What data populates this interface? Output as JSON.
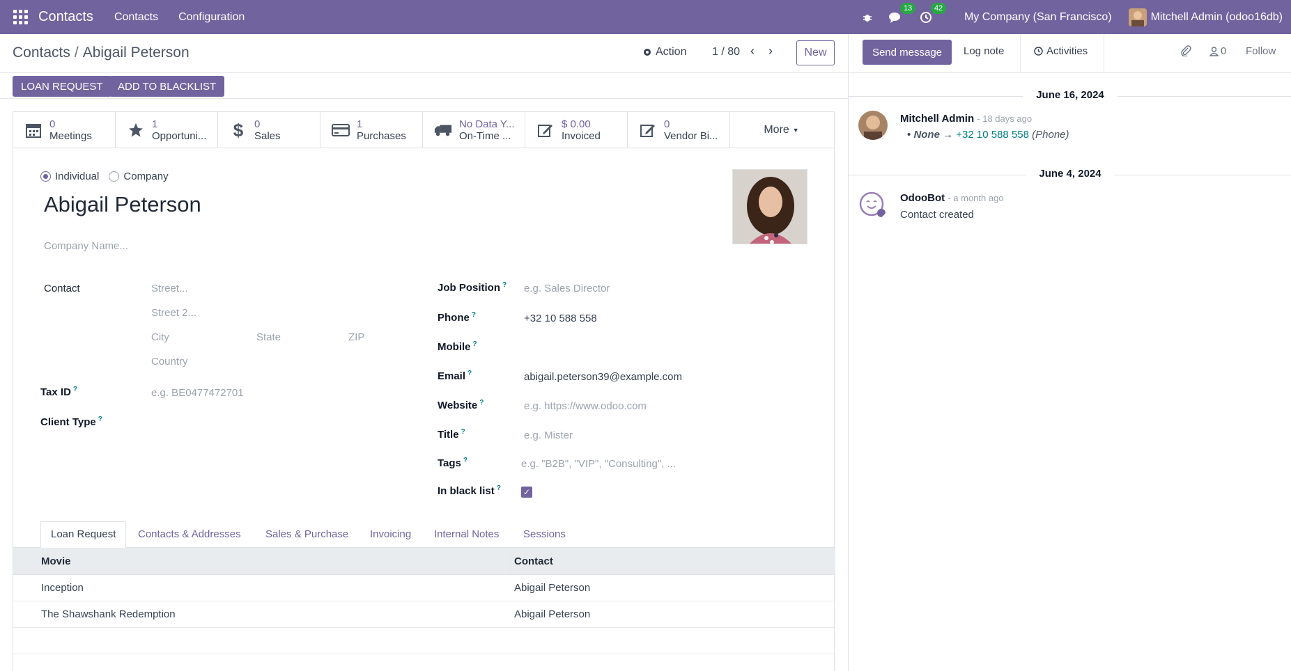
{
  "navbar": {
    "brand": "Contacts",
    "menus": [
      "Contacts",
      "Configuration"
    ],
    "messages_count": "13",
    "activities_count": "42",
    "company": "My Company (San Francisco)",
    "user": "Mitchell Admin (odoo16db)"
  },
  "control_panel": {
    "breadcrumb_parent": "Contacts",
    "breadcrumb_separator": "/",
    "breadcrumb_current": "Abigail Peterson",
    "action_label": "Action",
    "pager": "1 / 80",
    "new_label": "New"
  },
  "header_buttons": {
    "loan_request": "LOAN REQUEST",
    "add_to_blacklist": "ADD TO BLACKLIST"
  },
  "stat_buttons": [
    {
      "value": "0",
      "label": "Meetings",
      "icon": "calendar-icon"
    },
    {
      "value": "1",
      "label": "Opportuni...",
      "icon": "star-icon"
    },
    {
      "value": "0",
      "label": "Sales",
      "icon": "dollar-icon"
    },
    {
      "value": "1",
      "label": "Purchases",
      "icon": "credit-card-icon"
    },
    {
      "value": "No Data Y...",
      "label": "On-Time ...",
      "icon": "truck-icon"
    },
    {
      "value": "$ 0.00",
      "label": "Invoiced",
      "icon": "pencil-square-icon"
    },
    {
      "value": "0",
      "label": "Vendor Bi...",
      "icon": "pencil-square-icon"
    }
  ],
  "more_label": "More",
  "form": {
    "type_individual": "Individual",
    "type_company": "Company",
    "name": "Abigail Peterson",
    "company_name_placeholder": "Company Name...",
    "contact_label": "Contact",
    "street_placeholder": "Street...",
    "street2_placeholder": "Street 2...",
    "city_placeholder": "City",
    "state_placeholder": "State",
    "zip_placeholder": "ZIP",
    "country_placeholder": "Country",
    "tax_id_label": "Tax ID",
    "tax_id_placeholder": "e.g. BE0477472701",
    "client_type_label": "Client Type",
    "job_position_label": "Job Position",
    "job_position_placeholder": "e.g. Sales Director",
    "phone_label": "Phone",
    "phone_value": "+32 10 588 558",
    "mobile_label": "Mobile",
    "email_label": "Email",
    "email_value": "abigail.peterson39@example.com",
    "website_label": "Website",
    "website_placeholder": "e.g. https://www.odoo.com",
    "title_label": "Title",
    "title_placeholder": "e.g. Mister",
    "tags_label": "Tags",
    "tags_placeholder": "e.g. \"B2B\", \"VIP\", \"Consulting\", ...",
    "blacklist_label": "In black list",
    "help_mark": "?"
  },
  "tabs": [
    "Loan Request",
    "Contacts & Addresses",
    "Sales & Purchase",
    "Invoicing",
    "Internal Notes",
    "Sessions"
  ],
  "table": {
    "columns": [
      "Movie",
      "Contact"
    ],
    "rows": [
      [
        "Inception",
        "Abigail Peterson"
      ],
      [
        "The Shawshank Redemption",
        "Abigail Peterson"
      ]
    ]
  },
  "chatter": {
    "send_message": "Send message",
    "log_note": "Log note",
    "activities": "Activities",
    "followers_count": "0",
    "follow": "Follow",
    "date1": "June 16, 2024",
    "msg1_author": "Mitchell Admin",
    "msg1_time": "- 18 days ago",
    "msg1_old": "None",
    "msg1_new": "+32 10 588 558",
    "msg1_field": "(Phone)",
    "date2": "June 4, 2024",
    "msg2_author": "OdooBot",
    "msg2_time": "- a month ago",
    "msg2_body": "Contact created"
  },
  "colors": {
    "brand": "#71639e",
    "badge": "#28a745",
    "link": "#017e84"
  }
}
